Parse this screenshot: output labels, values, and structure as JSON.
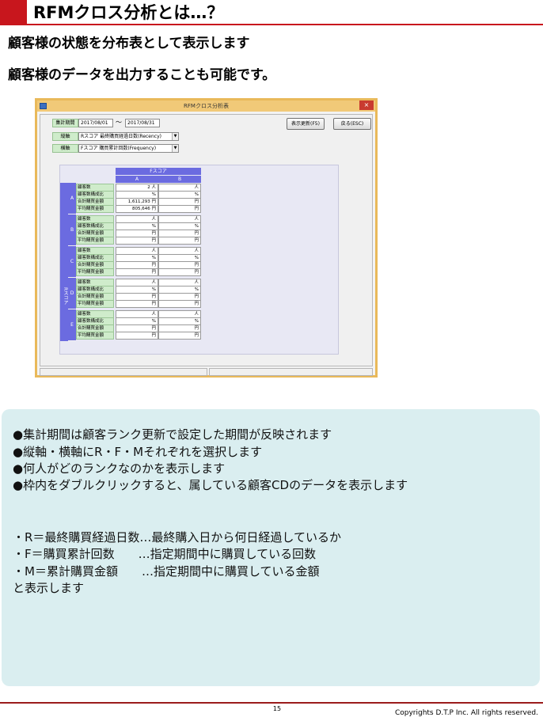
{
  "header": {
    "title": "RFMクロス分析とは…？",
    "subtitle1": "顧客様の状態を分布表として表示します",
    "subtitle2": "顧客様のデータを出力することも可能です。"
  },
  "window": {
    "title": "RFMクロス分析表",
    "close_label": "×",
    "period_label": "集計期間",
    "period_from": "2017/08/01",
    "period_tilde": "～",
    "period_to": "2017/08/31",
    "vertical_axis_label": "縦軸",
    "vertical_axis_value": "Rスコア 最終購買経過日数(Recency)",
    "horizontal_axis_label": "横軸",
    "horizontal_axis_value": "Fスコア 購買累計回数(Frequency)",
    "dropdown_arrow": "▼",
    "refresh_button": "表示更新(F5)",
    "back_button": "戻る(ESC)"
  },
  "grid": {
    "column_group": "Fスコア",
    "columns": [
      "A",
      "B"
    ],
    "row_group": "Rスコア",
    "metrics": [
      "顧客数",
      "顧客数構成比",
      "合計購買金額",
      "平均購買金額"
    ],
    "rows": [
      {
        "key": "A",
        "cells": [
          [
            "2 人",
            "%",
            "1,611,293 円",
            "805,646 円"
          ],
          [
            "人",
            "%",
            "円",
            "円"
          ]
        ]
      },
      {
        "key": "B",
        "cells": [
          [
            "人",
            "%",
            "円",
            "円"
          ],
          [
            "人",
            "%",
            "円",
            "円"
          ]
        ]
      },
      {
        "key": "C",
        "cells": [
          [
            "人",
            "%",
            "円",
            "円"
          ],
          [
            "人",
            "%",
            "円",
            "円"
          ]
        ]
      },
      {
        "key": "D",
        "cells": [
          [
            "人",
            "%",
            "円",
            "円"
          ],
          [
            "人",
            "%",
            "円",
            "円"
          ]
        ]
      },
      {
        "key": "E",
        "cells": [
          [
            "人",
            "%",
            "円",
            "円"
          ],
          [
            "人",
            "%",
            "円",
            "円"
          ]
        ]
      }
    ]
  },
  "info": {
    "bullets": [
      "●集計期間は顧客ランク更新で設定した期間が反映されます",
      "●縦軸・横軸にR・F・Mそれぞれを選択します",
      "●何人がどのランクなのかを表示します",
      "●枠内をダブルクリックすると、属している顧客CDのデータを表示します"
    ],
    "definitions": [
      "・R＝最終購買経過日数…最終購入日から何日経過しているか",
      "・F＝購買累計回数　　…指定期間中に購買している回数",
      "・M＝累計購買金額　　…指定期間中に購買している金額",
      "と表示します"
    ]
  },
  "footer": {
    "page_number": "15",
    "copyright": "Copyrights  D.T.P Inc. All rights reserved."
  }
}
